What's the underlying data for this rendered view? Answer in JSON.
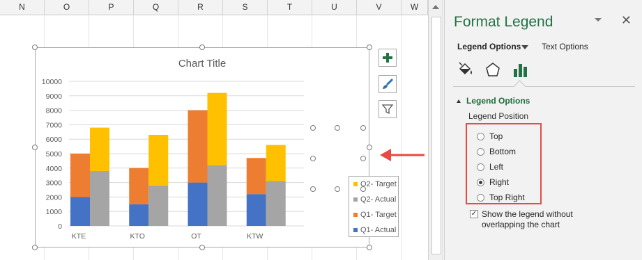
{
  "columns": [
    "N",
    "O",
    "P",
    "Q",
    "R",
    "S",
    "T",
    "U",
    "V",
    "W"
  ],
  "sidebar_buttons": [
    {
      "name": "chart-elements-button",
      "icon": "plus-icon"
    },
    {
      "name": "chart-styles-button",
      "icon": "brush-icon"
    },
    {
      "name": "chart-filters-button",
      "icon": "filter-icon"
    }
  ],
  "chart": {
    "title": "Chart Title",
    "legend_items": [
      "Q2- Target",
      "Q2- Actual",
      "Q1- Target",
      "Q1- Actual"
    ]
  },
  "chart_data": {
    "type": "bar",
    "stacked": true,
    "title": "Chart Title",
    "categories": [
      "KTE",
      "KTO",
      "OT",
      "KTW"
    ],
    "ylim": [
      0,
      10000
    ],
    "yticks": [
      0,
      1000,
      2000,
      3000,
      4000,
      5000,
      6000,
      7000,
      8000,
      9000,
      10000
    ],
    "grid": true,
    "legend_position": "right",
    "groups": [
      {
        "stack": "Q1",
        "series": [
          {
            "name": "Q1- Actual",
            "color": "#4472c4",
            "values": [
              2000,
              1500,
              3000,
              2200
            ]
          },
          {
            "name": "Q1- Target",
            "color": "#ed7d31",
            "values": [
              3000,
              2500,
              5000,
              2500
            ]
          }
        ]
      },
      {
        "stack": "Q2",
        "series": [
          {
            "name": "Q2- Actual",
            "color": "#a5a5a5",
            "values": [
              3800,
              2800,
              4200,
              3100
            ]
          },
          {
            "name": "Q2- Target",
            "color": "#ffc000",
            "values": [
              3000,
              3500,
              5000,
              2500
            ]
          }
        ]
      }
    ]
  },
  "panel": {
    "title": "Format Legend",
    "close": "✕",
    "tab_legend_options": "Legend Options",
    "tab_text_options": "Text Options",
    "section_title": "Legend Options",
    "position_label": "Legend Position",
    "positions": [
      {
        "label": "Top",
        "checked": false
      },
      {
        "label": "Bottom",
        "checked": false
      },
      {
        "label": "Left",
        "checked": false
      },
      {
        "label": "Right",
        "checked": true
      },
      {
        "label": "Top Right",
        "checked": false
      }
    ],
    "show_without_overlap": {
      "label": "Show the legend without overlapping the chart",
      "checked": true
    },
    "check_mark": "✓"
  },
  "colors": {
    "accent": "#217346",
    "annotation": "#e64a43"
  }
}
